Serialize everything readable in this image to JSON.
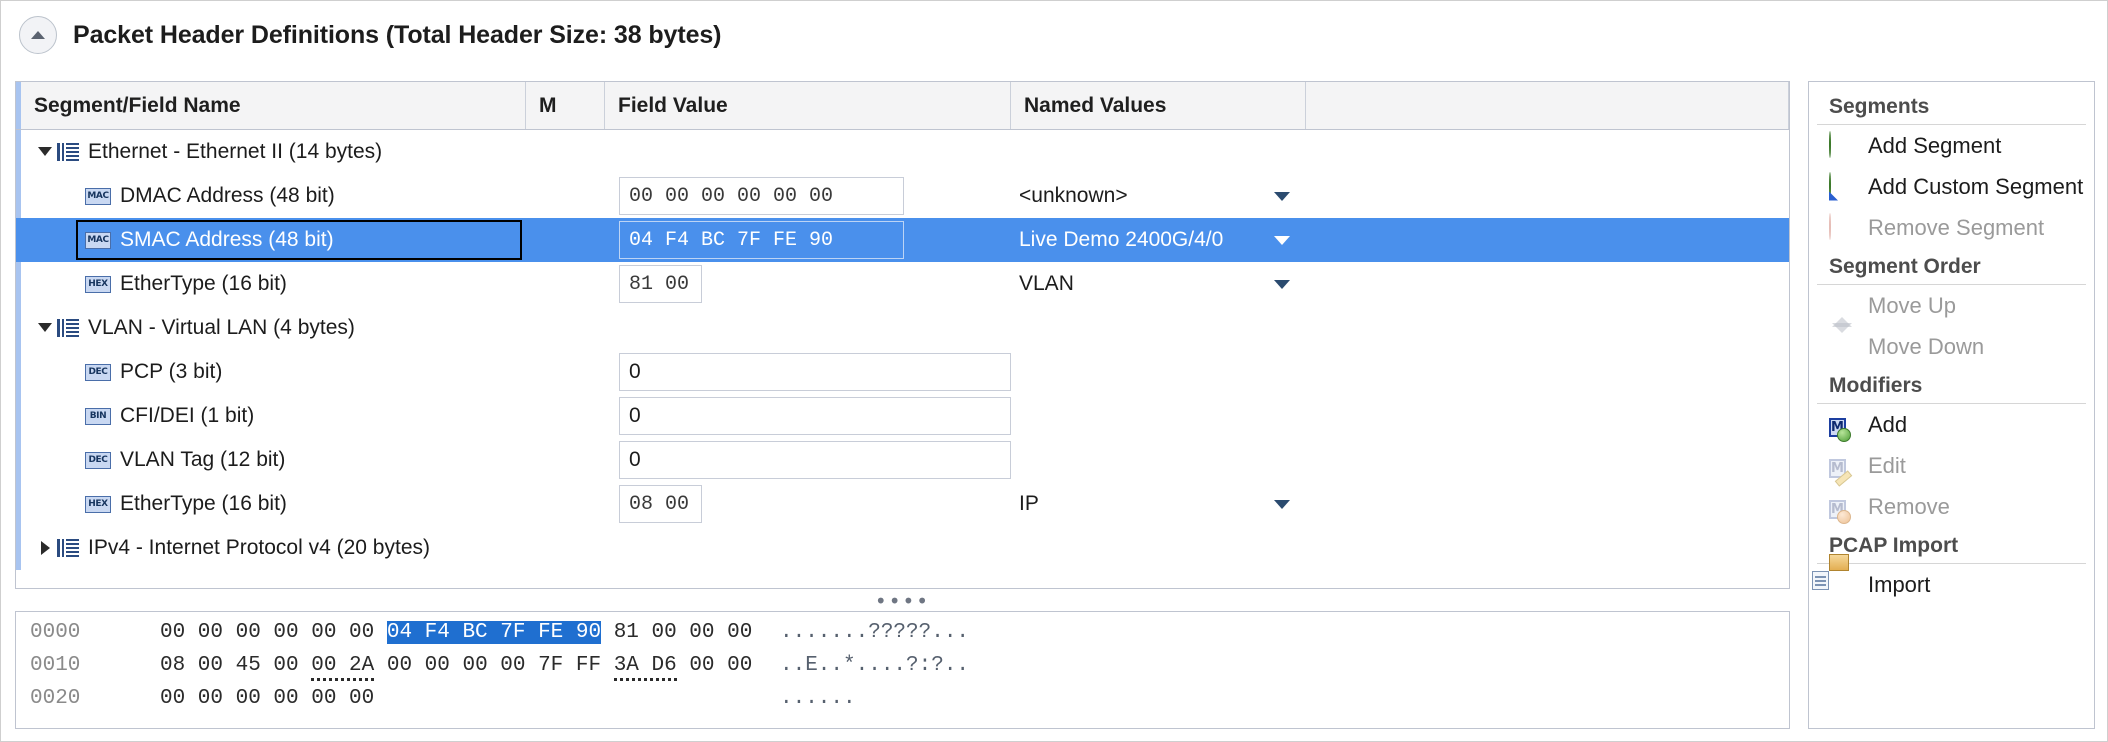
{
  "header": {
    "collapse_icon": "chevron-up-icon",
    "title": "Packet Header Definitions (Total Header Size: 38 bytes)"
  },
  "grid": {
    "columns": [
      {
        "key": "name",
        "label": "Segment/Field Name"
      },
      {
        "key": "m",
        "label": "M"
      },
      {
        "key": "value",
        "label": "Field Value"
      },
      {
        "key": "named",
        "label": "Named Values"
      },
      {
        "key": "rest",
        "label": ""
      }
    ],
    "rows": [
      {
        "kind": "segment",
        "expanded": true,
        "icon": "segment-icon",
        "label": "Ethernet - Ethernet II (14 bytes)",
        "value": "",
        "named": "",
        "selected": false
      },
      {
        "kind": "field",
        "badge": "MAC",
        "icon": "mac-type-icon",
        "label": "DMAC Address (48 bit)",
        "value": "00 00 00 00 00 00",
        "value_style": "hex-wide",
        "named": "<unknown>",
        "has_dropdown": true,
        "selected": false
      },
      {
        "kind": "field",
        "badge": "MAC",
        "icon": "mac-type-icon",
        "label": "SMAC Address (48 bit)",
        "value": "04 F4 BC 7F FE 90",
        "value_style": "hex-wide",
        "named": "Live Demo 2400G/4/0",
        "has_dropdown": true,
        "selected": true
      },
      {
        "kind": "field",
        "badge": "HEX",
        "icon": "hex-type-icon",
        "label": "EtherType (16 bit)",
        "value": "81 00",
        "value_style": "hex-narrow",
        "named": "VLAN",
        "has_dropdown": true,
        "selected": false
      },
      {
        "kind": "segment",
        "expanded": true,
        "icon": "segment-icon",
        "label": "VLAN - Virtual LAN (4 bytes)",
        "value": "",
        "named": "",
        "selected": false
      },
      {
        "kind": "field",
        "badge": "DEC",
        "icon": "dec-type-icon",
        "label": "PCP (3 bit)",
        "value": "0",
        "value_style": "plain-full",
        "named": "",
        "has_dropdown": false,
        "selected": false
      },
      {
        "kind": "field",
        "badge": "BIN",
        "icon": "bin-type-icon",
        "label": "CFI/DEI (1 bit)",
        "value": "0",
        "value_style": "plain-full",
        "named": "",
        "has_dropdown": false,
        "selected": false
      },
      {
        "kind": "field",
        "badge": "DEC",
        "icon": "dec-type-icon",
        "label": "VLAN Tag (12 bit)",
        "value": "0",
        "value_style": "plain-full",
        "named": "",
        "has_dropdown": false,
        "selected": false
      },
      {
        "kind": "field",
        "badge": "HEX",
        "icon": "hex-type-icon",
        "label": "EtherType (16 bit)",
        "value": "08 00",
        "value_style": "hex-narrow",
        "named": "IP",
        "has_dropdown": true,
        "selected": false
      },
      {
        "kind": "segment",
        "expanded": false,
        "icon": "segment-icon",
        "label": "IPv4 - Internet Protocol v4 (20 bytes)",
        "value": "",
        "named": "",
        "selected": false
      }
    ]
  },
  "splitter": {
    "grip": "••••"
  },
  "hexdump": {
    "lines": [
      {
        "offset": "0000",
        "pre": "00 00 00 00 00 00 ",
        "highlight": "04 F4 BC 7F FE 90",
        "post": " 81 00 00 00",
        "ascii": ".......?????..."
      },
      {
        "offset": "0010",
        "pre": "08 00 45 00 ",
        "underline_a": "00 2A",
        "mid": " 00 00 00 00 7F FF ",
        "underline_b": "3A D6",
        "post": " 00 00",
        "ascii": "..E..*....?:?.."
      },
      {
        "offset": "0020",
        "pre": "00 00 00 00 00 00",
        "ascii": "......"
      }
    ]
  },
  "sidebar": {
    "groups": [
      {
        "title": "Segments",
        "items": [
          {
            "label": "Add Segment",
            "icon": "add-circle-icon",
            "disabled": false
          },
          {
            "label": "Add Custom Segment",
            "icon": "add-custom-icon",
            "disabled": false
          },
          {
            "label": "Remove Segment",
            "icon": "remove-circle-icon",
            "disabled": true
          }
        ]
      },
      {
        "title": "Segment Order",
        "items": [
          {
            "label": "Move Up",
            "icon": "arrow-up-icon",
            "disabled": true
          },
          {
            "label": "Move Down",
            "icon": "arrow-down-icon",
            "disabled": true
          }
        ]
      },
      {
        "title": "Modifiers",
        "items": [
          {
            "label": "Add",
            "icon": "modifier-add-icon",
            "disabled": false
          },
          {
            "label": "Edit",
            "icon": "modifier-edit-icon",
            "disabled": true
          },
          {
            "label": "Remove",
            "icon": "modifier-remove-icon",
            "disabled": true
          }
        ]
      },
      {
        "title": "PCAP Import",
        "items": [
          {
            "label": "Import",
            "icon": "import-folder-icon",
            "disabled": false
          }
        ]
      }
    ]
  },
  "colors": {
    "selection_blue": "#4a90ec",
    "hex_highlight_blue": "#1f6fd0",
    "header_gray": "#f4f4f5",
    "border_gray": "#bfc4d0"
  }
}
